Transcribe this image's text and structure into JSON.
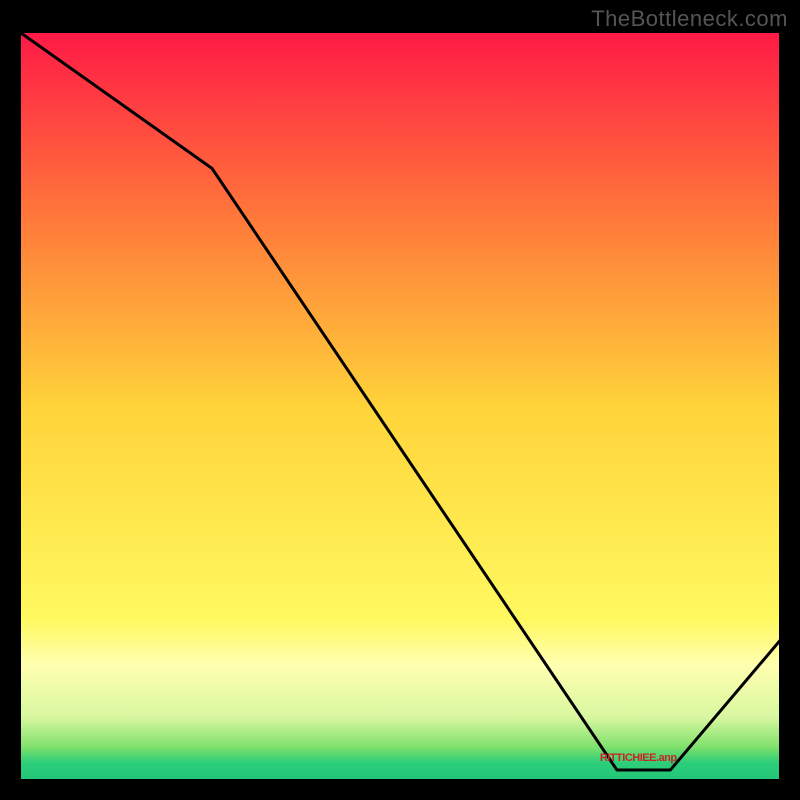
{
  "watermark": "TheBottleneck.com",
  "red_label": "RITTICHIEE.anp",
  "chart_data": {
    "type": "line",
    "title": "",
    "xlabel": "",
    "ylabel": "",
    "xlim": [
      0,
      100
    ],
    "ylim": [
      0,
      100
    ],
    "grid": false,
    "background_gradient": [
      {
        "stop": 0.0,
        "color": "#ff1a46"
      },
      {
        "stop": 0.25,
        "color": "#ff7a3a"
      },
      {
        "stop": 0.5,
        "color": "#ffd43a"
      },
      {
        "stop": 0.78,
        "color": "#fff960"
      },
      {
        "stop": 0.84,
        "color": "#ffffb0"
      },
      {
        "stop": 0.91,
        "color": "#d8f7a0"
      },
      {
        "stop": 0.95,
        "color": "#7ee06c"
      },
      {
        "stop": 0.97,
        "color": "#2ecf7a"
      },
      {
        "stop": 1.0,
        "color": "#1fc178"
      }
    ],
    "series": [
      {
        "name": "curve",
        "color": "#000000",
        "points": [
          {
            "x": 0,
            "y": 100
          },
          {
            "x": 25,
            "y": 82
          },
          {
            "x": 78,
            "y": 2
          },
          {
            "x": 85,
            "y": 2
          },
          {
            "x": 100,
            "y": 20
          }
        ]
      }
    ],
    "annotations": [
      {
        "text": "RITTICHIEE.anp",
        "x": 81,
        "y": 3,
        "color": "#c22"
      }
    ]
  }
}
